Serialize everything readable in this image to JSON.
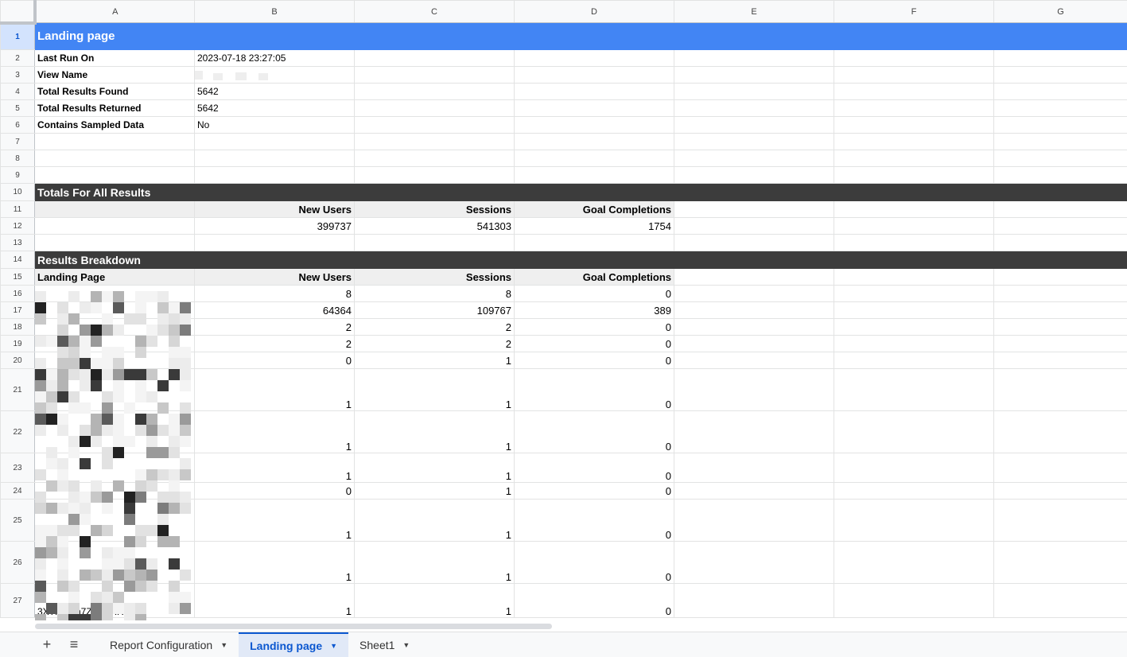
{
  "columns": [
    "A",
    "B",
    "C",
    "D",
    "E",
    "F",
    "G"
  ],
  "rows": {
    "r1": {
      "a": "Landing page"
    },
    "r2": {
      "a": "Last Run On",
      "b": "2023-07-18 23:27:05"
    },
    "r3": {
      "a": "View Name",
      "b": ""
    },
    "r4": {
      "a": "Total Results Found",
      "b": "5642"
    },
    "r5": {
      "a": "Total Results Returned",
      "b": "5642"
    },
    "r6": {
      "a": "Contains Sampled Data",
      "b": "No"
    },
    "r10": {
      "a": "Totals For All Results"
    },
    "r11": {
      "b": "New Users",
      "c": "Sessions",
      "d": "Goal Completions"
    },
    "r12": {
      "b": "399737",
      "c": "541303",
      "d": "1754"
    },
    "r14": {
      "a": "Results Breakdown"
    },
    "r15": {
      "a": "Landing Page",
      "b": "New Users",
      "c": "Sessions",
      "d": "Goal Completions"
    }
  },
  "breakdown": [
    {
      "row": "16",
      "new_users": "8",
      "sessions": "8",
      "goals": "0"
    },
    {
      "row": "17",
      "new_users": "64364",
      "sessions": "109767",
      "goals": "389"
    },
    {
      "row": "18",
      "new_users": "2",
      "sessions": "2",
      "goals": "0"
    },
    {
      "row": "19",
      "new_users": "2",
      "sessions": "2",
      "goals": "0"
    },
    {
      "row": "20",
      "new_users": "0",
      "sessions": "1",
      "goals": "0"
    },
    {
      "row": "21",
      "new_users": "1",
      "sessions": "1",
      "goals": "0"
    },
    {
      "row": "22",
      "new_users": "1",
      "sessions": "1",
      "goals": "0"
    },
    {
      "row": "23",
      "new_users": "1",
      "sessions": "1",
      "goals": "0"
    },
    {
      "row": "24",
      "new_users": "0",
      "sessions": "1",
      "goals": "0"
    },
    {
      "row": "25",
      "new_users": "1",
      "sessions": "1",
      "goals": "0"
    },
    {
      "row": "26",
      "new_users": "1",
      "sessions": "1",
      "goals": "0"
    },
    {
      "row": "27",
      "landing_page": "3XTfFRen7ZvBRRRsw",
      "new_users": "1",
      "sessions": "1",
      "goals": "0"
    }
  ],
  "row_numbers": [
    "1",
    "2",
    "3",
    "4",
    "5",
    "6",
    "7",
    "8",
    "9",
    "10",
    "11",
    "12",
    "13",
    "14",
    "15"
  ],
  "tabs": [
    {
      "label": "Report Configuration",
      "active": false
    },
    {
      "label": "Landing page",
      "active": true
    },
    {
      "label": "Sheet1",
      "active": false
    }
  ],
  "toolbar": {
    "add_icon": "+",
    "menu_icon": "≡"
  },
  "colors": {
    "title_bg": "#4285f4",
    "section_bg": "#3c3c3c",
    "active_tab": "#0b57d0"
  }
}
